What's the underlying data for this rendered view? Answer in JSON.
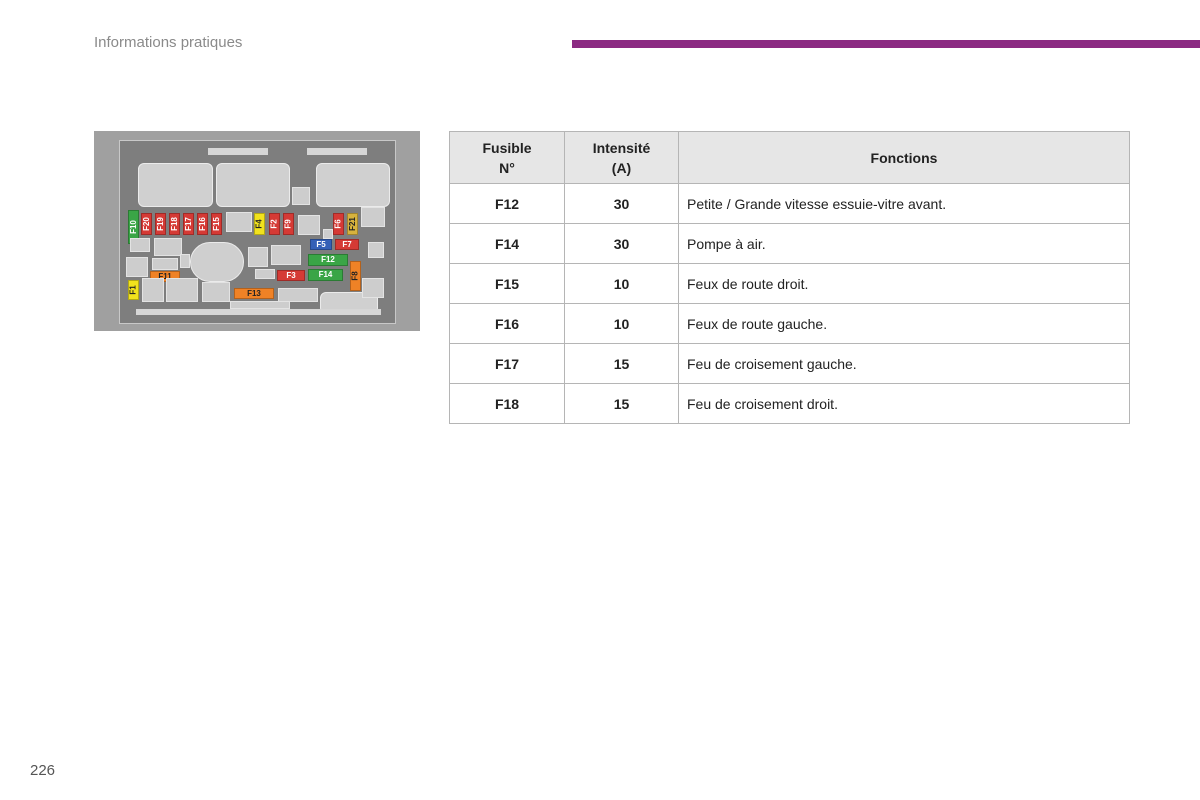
{
  "header": {
    "section_title": "Informations pratiques",
    "accent_color": "#8b2a82"
  },
  "footer": {
    "page_number": "226"
  },
  "fusebox_diagram": {
    "fuses": [
      {
        "label": "F10",
        "color": "#3aa546"
      },
      {
        "label": "F20",
        "color": "#d53a35"
      },
      {
        "label": "F19",
        "color": "#d53a35"
      },
      {
        "label": "F18",
        "color": "#d53a35"
      },
      {
        "label": "F17",
        "color": "#d53a35"
      },
      {
        "label": "F16",
        "color": "#d53a35"
      },
      {
        "label": "F15",
        "color": "#d53a35"
      },
      {
        "label": "F4",
        "color": "#f1e21d"
      },
      {
        "label": "F2",
        "color": "#d53a35"
      },
      {
        "label": "F9",
        "color": "#d53a35"
      },
      {
        "label": "F6",
        "color": "#d53a35"
      },
      {
        "label": "F21",
        "color": "#d7b23d"
      },
      {
        "label": "F5",
        "color": "#3460b7"
      },
      {
        "label": "F7",
        "color": "#d53a35"
      },
      {
        "label": "F12",
        "color": "#3aa546"
      },
      {
        "label": "F11",
        "color": "#ef8226"
      },
      {
        "label": "F3",
        "color": "#d53a35"
      },
      {
        "label": "F14",
        "color": "#3aa546"
      },
      {
        "label": "F8",
        "color": "#ef8226"
      },
      {
        "label": "F1",
        "color": "#f1e21d"
      },
      {
        "label": "F13",
        "color": "#ef8226"
      }
    ]
  },
  "table": {
    "headers": {
      "fuse_line1": "Fusible",
      "fuse_line2": "N°",
      "amp_line1": "Intensité",
      "amp_line2": "(A)",
      "functions": "Fonctions"
    },
    "rows": [
      {
        "fuse": "F12",
        "amps": "30",
        "function": "Petite / Grande vitesse essuie-vitre avant."
      },
      {
        "fuse": "F14",
        "amps": "30",
        "function": "Pompe à air."
      },
      {
        "fuse": "F15",
        "amps": "10",
        "function": "Feux de route droit."
      },
      {
        "fuse": "F16",
        "amps": "10",
        "function": "Feux de route gauche."
      },
      {
        "fuse": "F17",
        "amps": "15",
        "function": "Feu de croisement gauche."
      },
      {
        "fuse": "F18",
        "amps": "15",
        "function": "Feu de croisement droit."
      }
    ]
  }
}
